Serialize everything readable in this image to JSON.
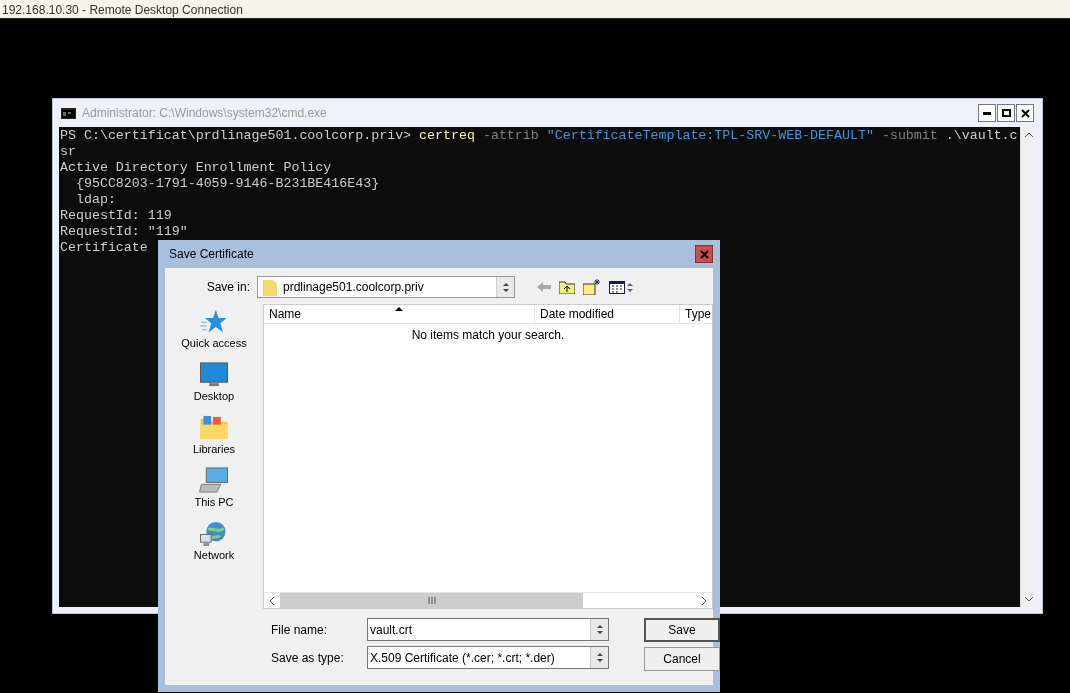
{
  "rdp_bar": {
    "title": "192.168.10.30 - Remote Desktop Connection"
  },
  "console": {
    "title": "Administrator: C:\\Windows\\system32\\cmd.exe",
    "lines": [
      [
        {
          "kind": "prompt",
          "text": "PS C:\\certificat\\prdlinage501.coolcorp.priv> "
        },
        {
          "kind": "command",
          "text": "certreq"
        },
        {
          "kind": "parameter",
          "text": " -attrib "
        },
        {
          "kind": "string",
          "text": "\"CertificateTemplate:TPL-SRV-WEB-DEFAULT\""
        },
        {
          "kind": "parameter",
          "text": " -submit "
        },
        {
          "kind": "plain",
          "text": ".\\vault.c"
        }
      ],
      [
        {
          "kind": "plain",
          "text": "sr"
        }
      ],
      [
        {
          "kind": "plain",
          "text": "Active Directory Enrollment Policy"
        }
      ],
      [
        {
          "kind": "plain",
          "text": "  {95CC8203-1791-4059-9146-B231BE416E43}"
        }
      ],
      [
        {
          "kind": "plain",
          "text": "  ldap:"
        }
      ],
      [
        {
          "kind": "plain",
          "text": "RequestId: 119"
        }
      ],
      [
        {
          "kind": "plain",
          "text": "RequestId: \"119\""
        }
      ],
      [
        {
          "kind": "plain",
          "text": "Certificate"
        }
      ]
    ]
  },
  "dialog": {
    "title": "Save Certificate",
    "save_in": {
      "label": "Save in:",
      "value": "prdlinage501.coolcorp.priv"
    },
    "places": [
      {
        "label": "Quick access",
        "kind": "star"
      },
      {
        "label": "Desktop",
        "kind": "desktop"
      },
      {
        "label": "Libraries",
        "kind": "libraries"
      },
      {
        "label": "This PC",
        "kind": "pc"
      },
      {
        "label": "Network",
        "kind": "network"
      }
    ],
    "columns": [
      "Name",
      "Date modified",
      "Type"
    ],
    "empty_message": "No items match your search.",
    "file_name": {
      "label": "File name:",
      "value": "vault.crt"
    },
    "save_as_type": {
      "label": "Save as type:",
      "value": "X.509 Certificate (*.cer; *.crt; *.der)"
    },
    "buttons": [
      "Save",
      "Cancel"
    ]
  }
}
